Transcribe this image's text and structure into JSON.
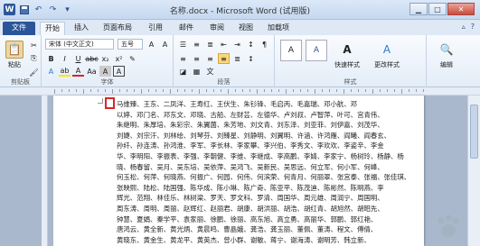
{
  "titlebar": {
    "title": "名称.docx - Microsoft Word (试用版)",
    "qat": [
      "word-logo-icon",
      "save-icon",
      "undo-icon",
      "redo-icon",
      "customize-icon"
    ],
    "minimize": "▁",
    "maximize": "□",
    "close": "✕"
  },
  "tabs": [
    {
      "label": "文件",
      "id": "file"
    },
    {
      "label": "开始",
      "id": "home",
      "active": true
    },
    {
      "label": "插入",
      "id": "insert"
    },
    {
      "label": "页面布局",
      "id": "layout"
    },
    {
      "label": "引用",
      "id": "references"
    },
    {
      "label": "邮件",
      "id": "mailings"
    },
    {
      "label": "审阅",
      "id": "review"
    },
    {
      "label": "视图",
      "id": "view"
    },
    {
      "label": "加载项",
      "id": "addins"
    }
  ],
  "ribbon": {
    "clipboard": {
      "label": "剪贴板",
      "paste": "粘贴"
    },
    "font": {
      "label": "字体",
      "font_name": "宋体 (中文正文)",
      "font_size": "五号"
    },
    "paragraph": {
      "label": "段落"
    },
    "styles": {
      "label": "样式",
      "quick_styles": "快速样式",
      "change_styles": "更改样式"
    },
    "editing": {
      "label": "编辑"
    }
  },
  "document": {
    "lines": [
      "马维臻、王东、二凤洋、王寿红、王伏生、朱钐锋、毛启丙、毛嘉瑞、邓小航、邓",
      "以婷、邓门名、邓东文、邓晓、古船、左财芸、左德华、卢刘叔、卢智萍、叶可、宫青伟、",
      "朱继明、朱厚培、朱彩宗、朱翼菌、朱芳地、刘文青、刘东泽、刘亚菲、刘伊嘉、刘茂华、",
      "刘婕、刘宗汗、刘林绘、刘琴芬、刘臻星、刘静明、刘翼明、许涵、许鸿雁、阎曦、阎春玄、",
      "孙纤、孙连涛、孙鸿淮、李军、李长林、李家攀、李兴伯、李秀文、李欢欢、李姿辛、李金",
      "华、李明阳、李振表、李强、李朝健、李维、李继成、李高鹏、李婧、李家宁、杨树玲、杨静、杨",
      "晓、杨春留、吴月、吴东培、吴依萍、吴鸿飞、吴新民、吴思远、何立军、何小军、何峰、",
      "何玉松、何萍、何晓燕、何振广、何园、何伟、何滨荣、何青月、何丽翠、张宫泰、张福、张佳琪、",
      "张映熙、陆松、陆国强、陈华成、陈小琳、陈广奇、陈亚平、陈茂迪、陈彬然、陈明燕、李",
      "辉光、范翔、林佳乐、林树梁、罗天、罗文科、罗清、周国华、周元雄、周润宁、周国明、",
      "周东涛、周明、周丽、赵辉红、赵丽君、胡康、胡洪丽、胡浩、胡红青、胡旭然、胡昭先、",
      "钟慧、夏娟、秦学平、袁家丽、徐鹏、徐丽、高东旭、高立勇、高丽华、郭鹏、郭红艳、",
      "唐鸿云、黄全新、黄光炳、黄晨鸣、曹晶娥、龚浩、龚玉丽、董佩、董涛、程文、傅倩、",
      "黄晓东、黄金生、黄龙平、黄英杰、曾小群、谢敏、蒋宁、谢海涛、谢明芳、韩立新、",
      "黄鹏、黄凯、黄兰娟、梁锦、梁柳、蔡荣、蔡晓凤、廖江宁、廖波、裴静、薛凡、薛锐"
    ]
  }
}
